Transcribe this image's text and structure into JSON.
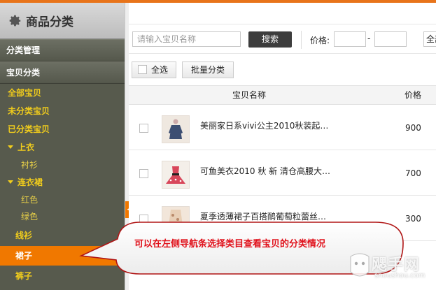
{
  "sidebar": {
    "title": "商品分类",
    "section_manage": "分类管理",
    "section_items": "宝贝分类",
    "items": [
      {
        "label": "全部宝贝"
      },
      {
        "label": "未分类宝贝"
      },
      {
        "label": "已分类宝贝"
      },
      {
        "label": "上衣"
      },
      {
        "label": "衬衫"
      },
      {
        "label": "连衣裙"
      },
      {
        "label": "红色"
      },
      {
        "label": "绿色"
      },
      {
        "label": "线衫"
      },
      {
        "label": "裙子"
      },
      {
        "label": "裤子"
      }
    ],
    "active_item": "裙子"
  },
  "search": {
    "placeholder": "请输入宝贝名称",
    "button_label": "搜索",
    "price_label": "价格:",
    "price_separator": "-",
    "range_select": "全部"
  },
  "actions": {
    "select_all": "全选",
    "batch_classify": "批量分类"
  },
  "table": {
    "headers": {
      "name": "宝贝名称",
      "price": "价格"
    },
    "rows": [
      {
        "name": "美丽家日系vivi公主2010秋装起…",
        "price": "900"
      },
      {
        "name": "可鱼美衣2010 秋 新 清仓高腰大…",
        "price": "700"
      },
      {
        "name": "夏季透薄裙子百搭鸸葡萄粒蕾丝…",
        "price": "300"
      }
    ]
  },
  "callout": {
    "text": "可以在左侧导航条选择类目查看宝贝的分类情况"
  },
  "watermark": {
    "brand": "飔手网",
    "url": "shoushou.com"
  },
  "colors": {
    "accent": "#f07800",
    "sidebar_bg": "#575a4d",
    "sidebar_text": "#f0cc1c",
    "callout_text": "#e0101a"
  }
}
